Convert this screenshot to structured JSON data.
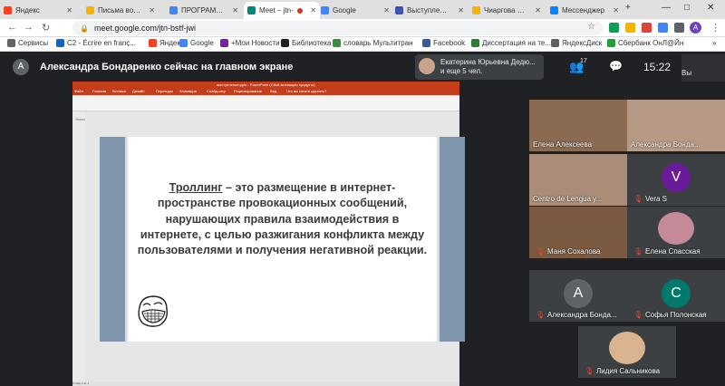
{
  "browser": {
    "tabs": [
      {
        "label": "Яндекс",
        "color": "#fc3f1d"
      },
      {
        "label": "Письма вопро",
        "color": "#f4b400"
      },
      {
        "label": "ПРОГРАММА",
        "color": "#4285f4"
      },
      {
        "label": "Meet – jtn-",
        "color": "#00897b",
        "active": true,
        "recording": true
      },
      {
        "label": "Google",
        "color": "#4285f4"
      },
      {
        "label": "Выступление",
        "color": "#3f51b5"
      },
      {
        "label": "Чиаргова 22.10",
        "color": "#f4b400"
      },
      {
        "label": "Мессенджер",
        "color": "#0084ff"
      }
    ],
    "new_tab": "+",
    "window_controls": [
      "—",
      "□",
      "✕"
    ],
    "url": "meet.google.com/jtn-bstf-jwi",
    "profile_initial": "A",
    "bookmarks": [
      {
        "label": "Сервисы",
        "color": "#5f6368"
      },
      {
        "label": "C2 - Écrire en franç...",
        "color": "#1565c0"
      },
      {
        "label": "Яндекс",
        "color": "#fc3f1d"
      },
      {
        "label": "Google",
        "color": "#4285f4"
      },
      {
        "label": "+Мои Новости",
        "color": "#7b1fa2"
      },
      {
        "label": "Библиотека",
        "color": "#212121"
      },
      {
        "label": "словарь Мультитран",
        "color": "#388e3c"
      },
      {
        "label": "Facebook",
        "color": "#3b5998"
      },
      {
        "label": "Диссертация на те...",
        "color": "#2e7d32"
      },
      {
        "label": "ЯндексДиск",
        "color": "#616161"
      },
      {
        "label": "Сбербанк ОнЛ@Йн",
        "color": "#21a038"
      }
    ],
    "bookmarks_more": "»"
  },
  "meet": {
    "presenter_initial": "A",
    "presenting_title": "Александра Бондаренко сейчас на главном экране",
    "people_card": {
      "line1": "Екатерина Юрьевна Дедю...",
      "line2": "и еще 5 чел."
    },
    "people_count": "17",
    "clock": "15:22",
    "self_label": "Вы"
  },
  "presentation": {
    "window_title": "выступление.pptx - PowerPoint (Сбой активации продукта)",
    "ribbon_tabs": [
      "Файл",
      "Главная",
      "Вставка",
      "Дизайн",
      "Переходы",
      "Анимация",
      "Слайд-шоу",
      "Рецензирование",
      "Вид",
      "Что вы хотите сделать?"
    ],
    "slide_number_label": "Эскиз",
    "slide": {
      "term": "Троллинг",
      "definition": " – это размещение в интернет-пространстве провокационных сообщений, нарушающих правила взаимодействия в интернете, с целью разжигания конфликта между пользователями и получения негативной реакции."
    },
    "status_left": "Слайд 1 из 1"
  },
  "participants": [
    {
      "name": "Елена Алексеева",
      "type": "video",
      "muted": false,
      "bg": "#8a6b52"
    },
    {
      "name": "Александра Бонда...",
      "type": "video",
      "muted": false,
      "bg": "#b79a86",
      "speaking": true
    },
    {
      "name": "Centro de Lengua y...",
      "type": "video",
      "muted": false,
      "bg": "#a98d78"
    },
    {
      "name": "Vera S",
      "type": "avatar",
      "initial": "V",
      "avatar_color": "#6a1b9a",
      "muted": true
    },
    {
      "name": "Маня Сохалова",
      "type": "video",
      "muted": true,
      "bg": "#7a5a40"
    },
    {
      "name": "Елена Спасская",
      "type": "photo",
      "muted": true,
      "photo_color": "#c48a9a"
    },
    {
      "name": "Александра Бонда...",
      "type": "avatar",
      "initial": "A",
      "avatar_color": "#5f6368",
      "muted": true
    },
    {
      "name": "Софья Полонская",
      "type": "avatar",
      "initial": "C",
      "avatar_color": "#00796b",
      "muted": true
    },
    {
      "name": "Лидия Сальникова",
      "type": "photo",
      "muted": true,
      "photo_color": "#d9b48f"
    }
  ],
  "icons": {
    "mic_off": "mic-off-icon",
    "people": "people-icon",
    "chat": "chat-icon",
    "lock": "lock-icon"
  }
}
